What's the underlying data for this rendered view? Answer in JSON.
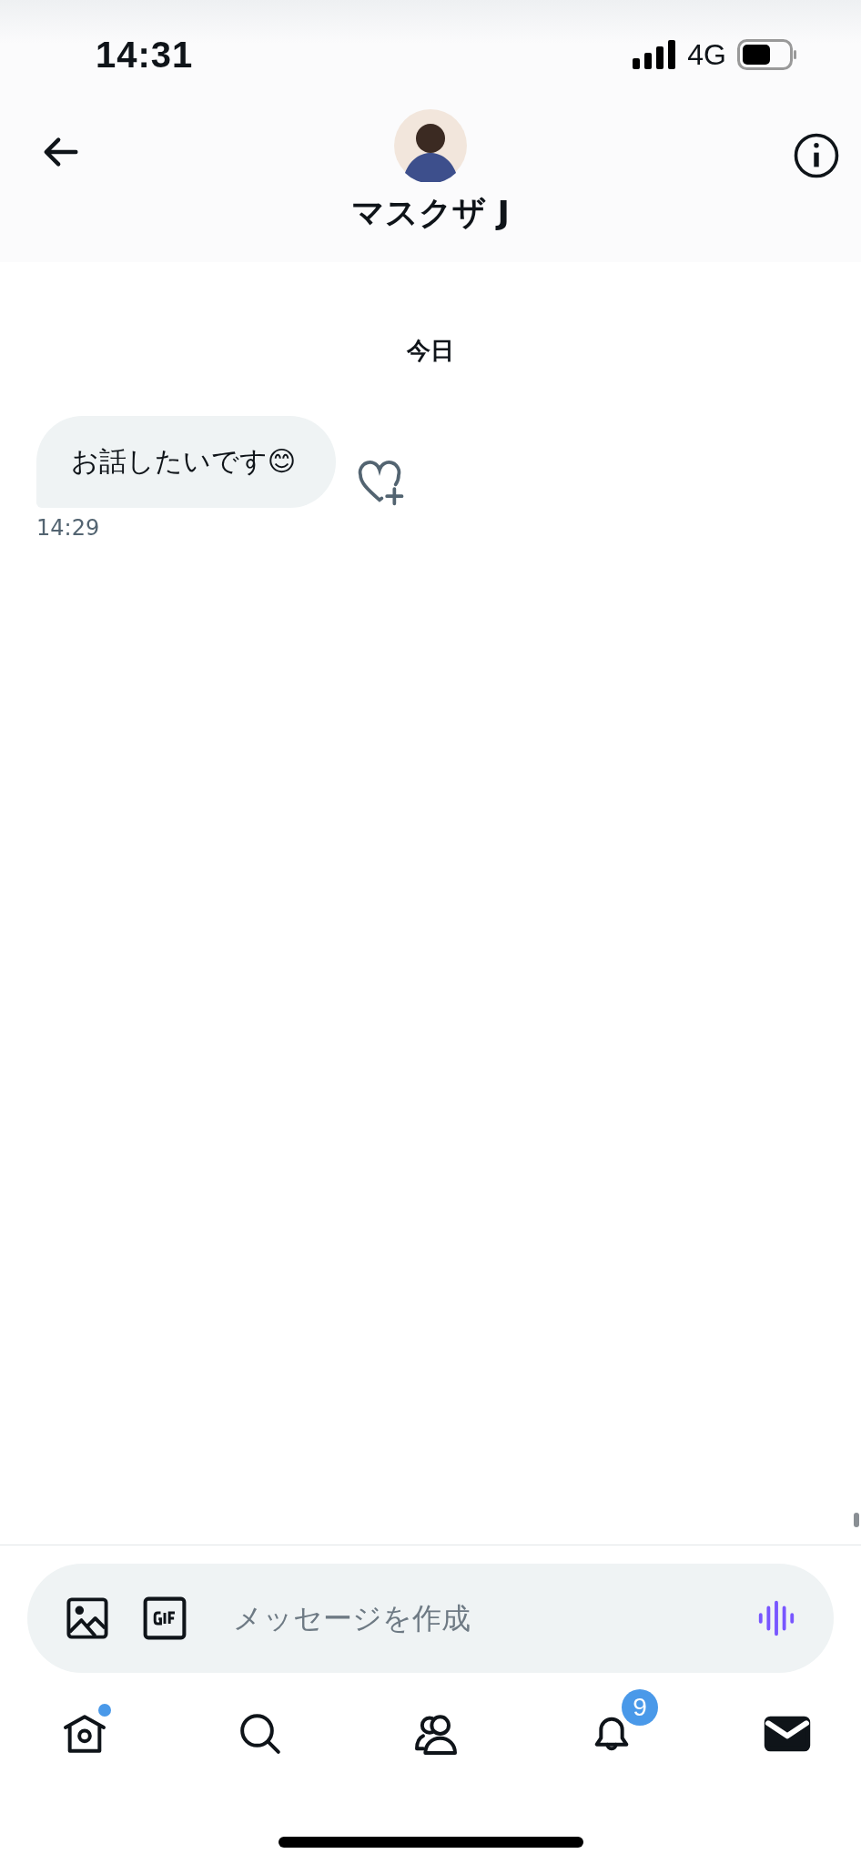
{
  "status_bar": {
    "time": "14:31",
    "network": "4G"
  },
  "header": {
    "name": "マスクザ J"
  },
  "date_divider": "今日",
  "messages": [
    {
      "text": "お話したいです😊",
      "time": "14:29"
    }
  ],
  "composer": {
    "placeholder": "メッセージを作成"
  },
  "nav": [
    {
      "kind": "home",
      "selected": false,
      "dot": true
    },
    {
      "kind": "search",
      "selected": false,
      "dot": false
    },
    {
      "kind": "communities",
      "selected": false,
      "dot": false
    },
    {
      "kind": "notifications",
      "selected": false,
      "dot": false,
      "badge": "9"
    },
    {
      "kind": "messages",
      "selected": true,
      "dot": false
    }
  ]
}
